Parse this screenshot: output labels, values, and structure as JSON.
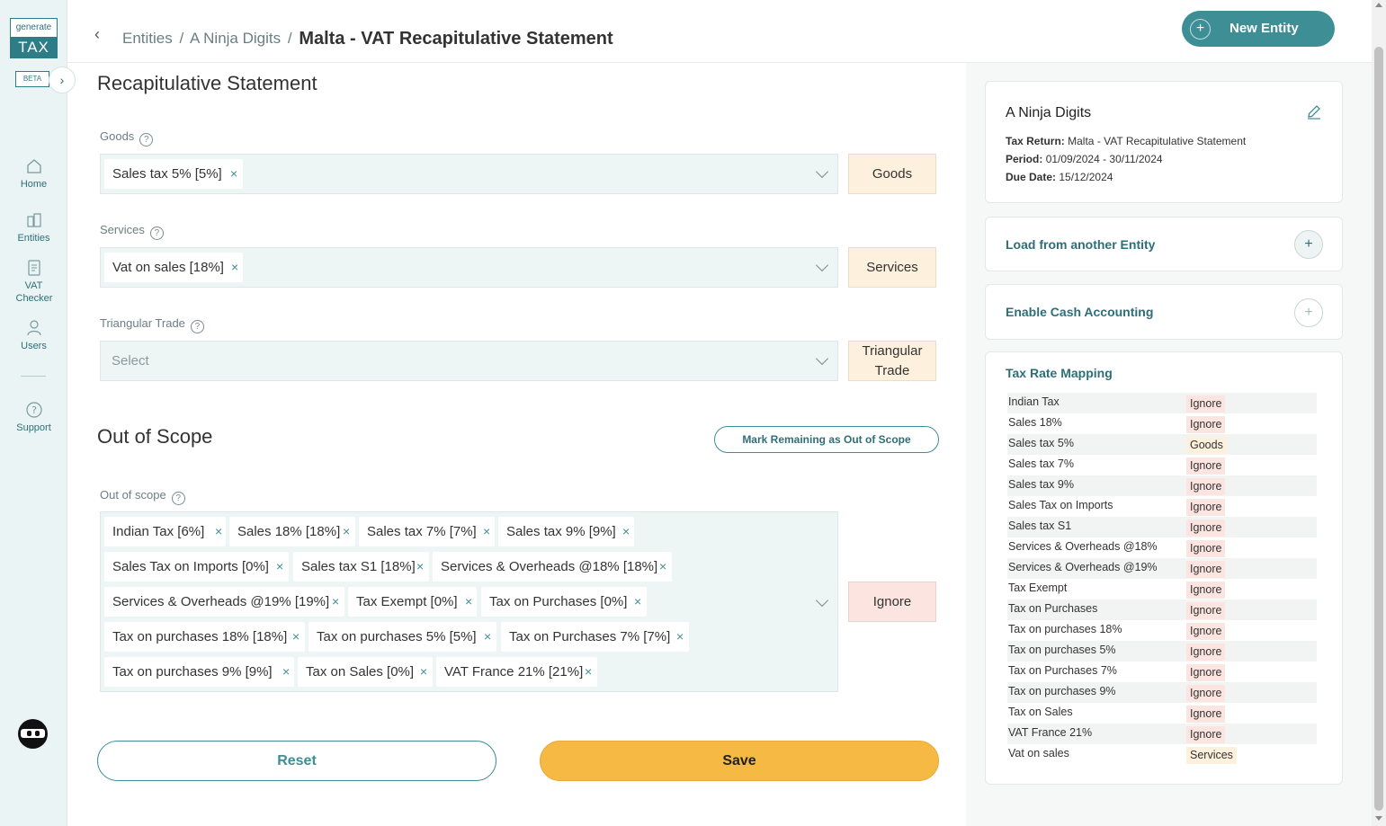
{
  "sidebar": {
    "logo_top": "generate",
    "logo_bottom": "TAX",
    "beta": "BETA",
    "items": [
      {
        "label": "Home"
      },
      {
        "label": "Entities"
      },
      {
        "label": "VAT Checker"
      },
      {
        "label": "Users"
      },
      {
        "label": "Support"
      }
    ]
  },
  "header": {
    "breadcrumb_1": "Entities",
    "breadcrumb_2": "A Ninja Digits",
    "separator": "/",
    "title": "Malta - VAT Recapitulative Statement",
    "new_entity": "New Entity"
  },
  "main": {
    "section_title": "Recapitulative Statement",
    "goods": {
      "label": "Goods",
      "tags": [
        "Sales tax 5% [5%]"
      ],
      "button": "Goods"
    },
    "services": {
      "label": "Services",
      "tags": [
        "Vat on sales [18%]"
      ],
      "button": "Services"
    },
    "triangular": {
      "label": "Triangular Trade",
      "placeholder": "Select",
      "button": "Triangular Trade"
    },
    "out_of_scope_title": "Out of Scope",
    "mark_remaining": "Mark Remaining as Out of Scope",
    "out_of_scope": {
      "label": "Out of scope",
      "tags": [
        "Indian Tax [6%]",
        "Sales 18% [18%]",
        "Sales tax 7% [7%]",
        "Sales tax 9% [9%]",
        "Sales Tax on Imports [0%]",
        "Sales tax S1 [18%]",
        "Services & Overheads @18% [18%]",
        "Services & Overheads @19% [19%]",
        "Tax Exempt [0%]",
        "Tax on Purchases [0%]",
        "Tax on purchases 18% [18%]",
        "Tax on purchases 5% [5%]",
        "Tax on Purchases 7% [7%]",
        "Tax on purchases 9% [9%]",
        "Tax on Sales [0%]",
        "VAT France 21% [21%]"
      ],
      "button": "Ignore"
    },
    "reset": "Reset",
    "save": "Save"
  },
  "panel": {
    "entity_name": "A Ninja Digits",
    "tax_return_label": "Tax Return:",
    "tax_return": "Malta - VAT Recapitulative Statement",
    "period_label": "Period:",
    "period": "01/09/2024 - 30/11/2024",
    "due_label": "Due Date:",
    "due": "15/12/2024",
    "load_from": "Load from another Entity",
    "cash_accounting": "Enable Cash Accounting",
    "mapping_title": "Tax Rate Mapping",
    "mapping": [
      {
        "name": "Indian Tax",
        "value": "Ignore"
      },
      {
        "name": "Sales 18%",
        "value": "Ignore"
      },
      {
        "name": "Sales tax 5%",
        "value": "Goods"
      },
      {
        "name": "Sales tax 7%",
        "value": "Ignore"
      },
      {
        "name": "Sales tax 9%",
        "value": "Ignore"
      },
      {
        "name": "Sales Tax on Imports",
        "value": "Ignore"
      },
      {
        "name": "Sales tax S1",
        "value": "Ignore"
      },
      {
        "name": "Services & Overheads @18%",
        "value": "Ignore"
      },
      {
        "name": "Services & Overheads @19%",
        "value": "Ignore"
      },
      {
        "name": "Tax Exempt",
        "value": "Ignore"
      },
      {
        "name": "Tax on Purchases",
        "value": "Ignore"
      },
      {
        "name": "Tax on purchases 18%",
        "value": "Ignore"
      },
      {
        "name": "Tax on purchases 5%",
        "value": "Ignore"
      },
      {
        "name": "Tax on Purchases 7%",
        "value": "Ignore"
      },
      {
        "name": "Tax on purchases 9%",
        "value": "Ignore"
      },
      {
        "name": "Tax on Sales",
        "value": "Ignore"
      },
      {
        "name": "VAT France 21%",
        "value": "Ignore"
      },
      {
        "name": "Vat on sales",
        "value": "Services"
      }
    ]
  },
  "colors": {
    "accent": "#3e8e96",
    "save": "#f6b944",
    "ignore_bg": "#fce5e1",
    "category_bg": "#fdf0dc"
  }
}
